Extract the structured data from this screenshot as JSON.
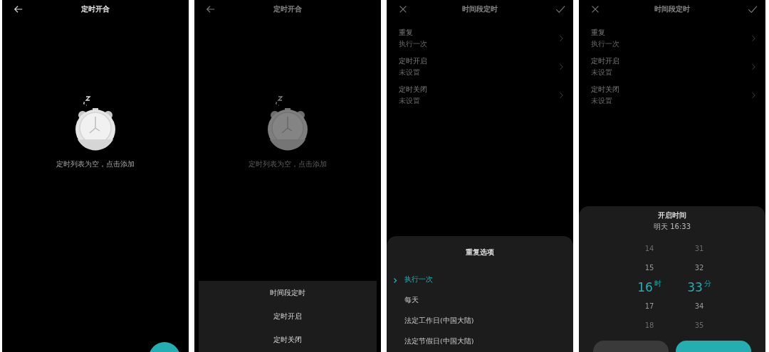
{
  "screens": [
    {
      "kind": "empty",
      "dimmed": false,
      "nav": {
        "kind": "back"
      },
      "title": "定时开合",
      "empty_text": "定时列表为空，点击添加"
    },
    {
      "kind": "empty",
      "dimmed": true,
      "nav": {
        "kind": "back"
      },
      "title": "定时开合",
      "empty_text": "定时列表为空，点击添加",
      "sheet": {
        "kind": "menu",
        "items": [
          {
            "label": "时间段定时"
          },
          {
            "label": "定时开启"
          },
          {
            "label": "定时关闭"
          }
        ]
      }
    },
    {
      "kind": "form",
      "dimmed": true,
      "nav": {
        "kind": "close"
      },
      "title": "时间段定时",
      "rows": [
        {
          "label": "重复",
          "value": "执行一次"
        },
        {
          "label": "定时开启",
          "value": "未设置"
        },
        {
          "label": "定时关闭",
          "value": "未设置"
        }
      ],
      "sheet": {
        "kind": "options",
        "title": "重复选项",
        "items": [
          {
            "label": "执行一次",
            "selected": true
          },
          {
            "label": "每天",
            "selected": false
          },
          {
            "label": "法定工作日(中国大陆)",
            "selected": false
          },
          {
            "label": "法定节假日(中国大陆)",
            "selected": false
          }
        ]
      }
    },
    {
      "kind": "form",
      "dimmed": true,
      "nav": {
        "kind": "close"
      },
      "title": "时间段定时",
      "rows": [
        {
          "label": "重复",
          "value": "执行一次"
        },
        {
          "label": "定时开启",
          "value": "未设置"
        },
        {
          "label": "定时关闭",
          "value": "未设置"
        }
      ],
      "sheet": {
        "kind": "picker",
        "title": "开启时间",
        "subtitle": "明天 16:33",
        "columns": [
          {
            "unit": "时",
            "items": [
              {
                "value": "14",
                "selected": false
              },
              {
                "value": "15",
                "selected": false
              },
              {
                "value": "16",
                "selected": true
              },
              {
                "value": "17",
                "selected": false
              },
              {
                "value": "18",
                "selected": false
              }
            ]
          },
          {
            "unit": "分",
            "items": [
              {
                "value": "31",
                "selected": false
              },
              {
                "value": "32",
                "selected": false
              },
              {
                "value": "33",
                "selected": true
              },
              {
                "value": "34",
                "selected": false
              },
              {
                "value": "35",
                "selected": false
              }
            ]
          }
        ]
      }
    }
  ]
}
